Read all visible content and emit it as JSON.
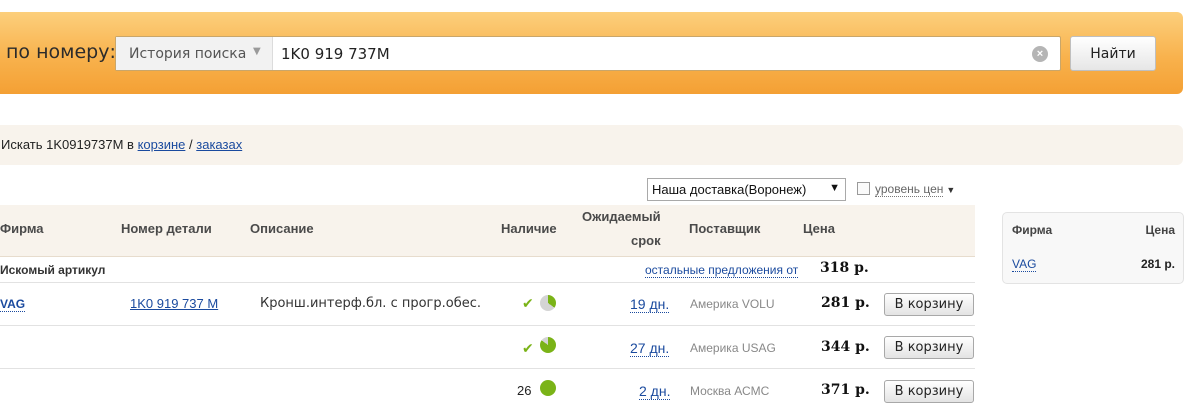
{
  "search": {
    "label": "по номеру:",
    "history_label": "История поиска",
    "query": "1K0 919 737M",
    "find_label": "Найти"
  },
  "cart_search": {
    "prefix": "Искать 1K0919737M в",
    "cart_link": "корзине",
    "separator": "/",
    "orders_link": "заказах"
  },
  "filters": {
    "delivery_selected": "Наша доставка(Воронеж)",
    "price_level_label": "уровень цен"
  },
  "table": {
    "headers": {
      "brand": "Фирма",
      "part_number": "Номер детали",
      "description": "Описание",
      "availability": "Наличие",
      "expected_line1": "Ожидаемый",
      "expected_line2": "срок",
      "supplier": "Поставщик",
      "price": "Цена"
    },
    "group": {
      "label": "Искомый артикул",
      "other_offers": "остальные предложения от",
      "min_price": "318 р."
    },
    "rows": [
      {
        "brand": "VAG",
        "part_number": "1K0 919 737 M",
        "description": "Кронш.интерф.бл. с прогр.обес.",
        "availability_qty": "",
        "availability_fraction": 0.35,
        "days": "19 дн.",
        "supplier": "Америка VOLU",
        "price": "281 р.",
        "cart_label": "В корзину"
      },
      {
        "brand": "",
        "part_number": "",
        "description": "",
        "availability_qty": "",
        "availability_fraction": 0.85,
        "days": "27 дн.",
        "supplier": "Америка USAG",
        "price": "344 р.",
        "cart_label": "В корзину"
      },
      {
        "brand": "",
        "part_number": "",
        "description": "",
        "availability_qty": "26",
        "availability_fraction": 1.0,
        "days": "2 дн.",
        "supplier": "Москва АСМС",
        "price": "371 р.",
        "cart_label": "В корзину"
      }
    ]
  },
  "side_box": {
    "brand_header": "Фирма",
    "price_header": "Цена",
    "brand": "VAG",
    "price": "281 р."
  },
  "colors": {
    "banner_top": "#fccf7c",
    "banner_bottom": "#f4a034",
    "link": "#1a4a9e",
    "pie_green": "#7ab317",
    "pie_gray": "#d4d4d4"
  }
}
